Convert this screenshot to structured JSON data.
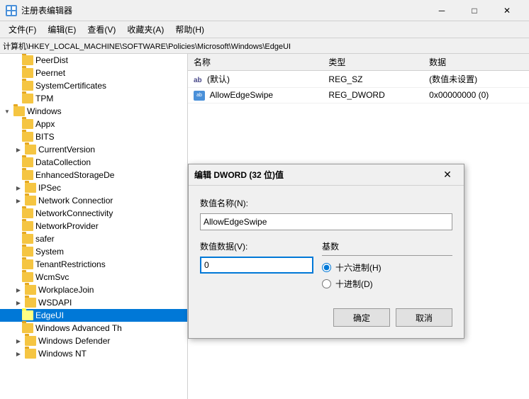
{
  "window": {
    "title": "注册表编辑器",
    "min_btn": "─",
    "max_btn": "□",
    "close_btn": "✕"
  },
  "menu": {
    "items": [
      "文件(F)",
      "编辑(E)",
      "查看(V)",
      "收藏夹(A)",
      "帮助(H)"
    ]
  },
  "address": {
    "label": "计算机\\HKEY_LOCAL_MACHINE\\SOFTWARE\\Policies\\Microsoft\\Windows\\EdgeUI"
  },
  "tree": {
    "items": [
      {
        "label": "PeerDist",
        "level": 1,
        "expanded": false,
        "selected": false
      },
      {
        "label": "Peernet",
        "level": 1,
        "expanded": false,
        "selected": false
      },
      {
        "label": "SystemCertificates",
        "level": 1,
        "expanded": false,
        "selected": false
      },
      {
        "label": "TPM",
        "level": 1,
        "expanded": false,
        "selected": false
      },
      {
        "label": "Windows",
        "level": 0,
        "expanded": true,
        "selected": false
      },
      {
        "label": "Appx",
        "level": 1,
        "expanded": false,
        "selected": false
      },
      {
        "label": "BITS",
        "level": 1,
        "expanded": false,
        "selected": false
      },
      {
        "label": "CurrentVersion",
        "level": 1,
        "expanded": false,
        "selected": false
      },
      {
        "label": "DataCollection",
        "level": 1,
        "expanded": false,
        "selected": false
      },
      {
        "label": "EnhancedStorageDe",
        "level": 1,
        "expanded": false,
        "selected": false
      },
      {
        "label": "IPSec",
        "level": 1,
        "expanded": false,
        "selected": false
      },
      {
        "label": "Network Connectior",
        "level": 1,
        "expanded": false,
        "selected": false
      },
      {
        "label": "NetworkConnectivity",
        "level": 1,
        "expanded": false,
        "selected": false
      },
      {
        "label": "NetworkProvider",
        "level": 1,
        "expanded": false,
        "selected": false
      },
      {
        "label": "safer",
        "level": 1,
        "expanded": false,
        "selected": false
      },
      {
        "label": "System",
        "level": 1,
        "expanded": false,
        "selected": false
      },
      {
        "label": "TenantRestrictions",
        "level": 1,
        "expanded": false,
        "selected": false
      },
      {
        "label": "WcmSvc",
        "level": 1,
        "expanded": false,
        "selected": false
      },
      {
        "label": "WorkplaceJoin",
        "level": 1,
        "expanded": false,
        "selected": false
      },
      {
        "label": "WSDAPI",
        "level": 1,
        "expanded": false,
        "selected": false
      },
      {
        "label": "EdgeUI",
        "level": 1,
        "expanded": false,
        "selected": true
      },
      {
        "label": "Windows Advanced Th",
        "level": 1,
        "expanded": false,
        "selected": false
      },
      {
        "label": "Windows Defender",
        "level": 1,
        "expanded": false,
        "selected": false
      },
      {
        "label": "Windows NT",
        "level": 1,
        "expanded": false,
        "selected": false
      }
    ]
  },
  "registry_values": {
    "columns": [
      "名称",
      "类型",
      "数据"
    ],
    "rows": [
      {
        "icon": "ab",
        "name": "(默认)",
        "type": "REG_SZ",
        "data": "(数值未设置)"
      },
      {
        "icon": "dword",
        "name": "AllowEdgeSwipe",
        "type": "REG_DWORD",
        "data": "0x00000000 (0)"
      }
    ]
  },
  "dialog": {
    "title": "编辑 DWORD (32 位)值",
    "close_btn": "✕",
    "name_label": "数值名称(N):",
    "name_value": "AllowEdgeSwipe",
    "data_label": "数值数据(V):",
    "data_value": "0",
    "base_group_label": "基数",
    "radio_hex_label": "十六进制(H)",
    "radio_dec_label": "十进制(D)",
    "ok_label": "确定",
    "cancel_label": "取消"
  }
}
